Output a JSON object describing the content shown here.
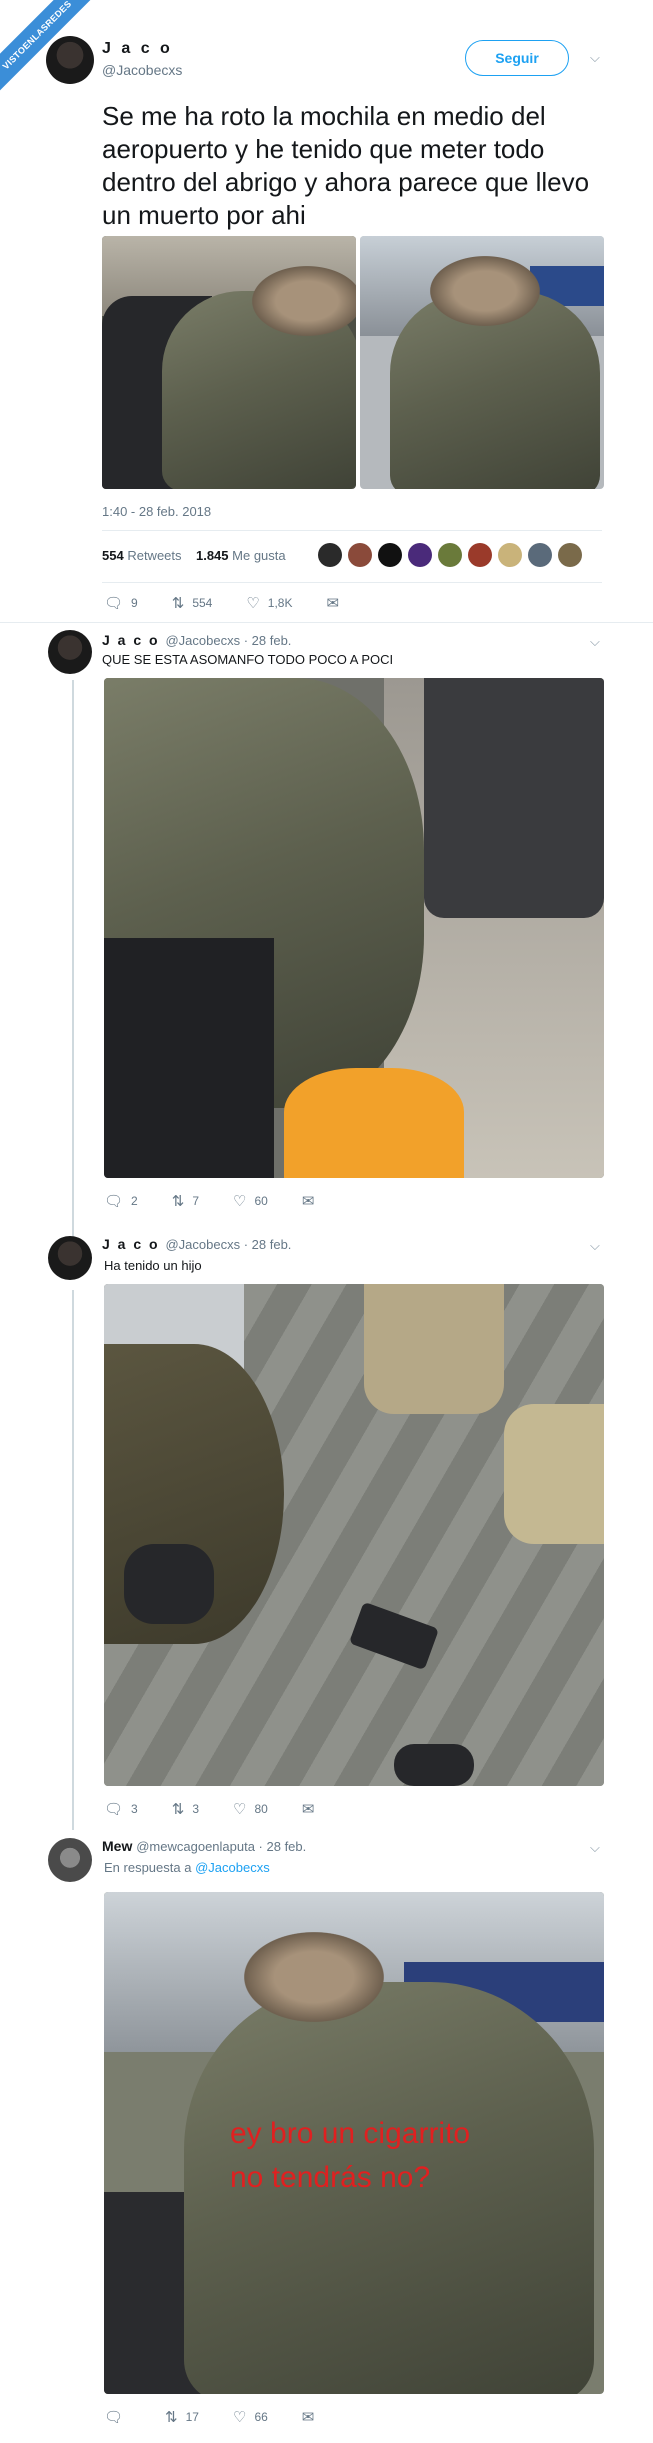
{
  "watermark": "VISTOENLASREDES",
  "tweet": {
    "name": "J a c o",
    "handle": "@Jacobecxs",
    "follow_label": "Seguir",
    "text": "Se me ha roto la mochila en medio del aeropuerto y he tenido que meter todo dentro del abrigo y ahora parece que llevo un muerto por ahi",
    "timestamp": "1:40 - 28 feb. 2018",
    "retweets_count": "554",
    "retweets_label": "Retweets",
    "likes_count": "1.845",
    "likes_label": "Me gusta",
    "actions": {
      "replies": "9",
      "retweets": "554",
      "likes": "1,8K"
    }
  },
  "replies": [
    {
      "name": "J a c o",
      "meta": "@Jacobecxs · 28 feb.",
      "text": "QUE SE ESTA ASOMANFO TODO POCO A POCI",
      "actions": {
        "replies": "2",
        "retweets": "7",
        "likes": "60"
      }
    },
    {
      "name": "J a c o",
      "meta": "@Jacobecxs · 28 feb.",
      "text": "Ha tenido un hijo",
      "actions": {
        "replies": "3",
        "retweets": "3",
        "likes": "80"
      }
    },
    {
      "name": "Mew",
      "meta": "@mewcagoenlaputa · 28 feb.",
      "reply_prefix": "En respuesta a",
      "reply_target": "@Jacobecxs",
      "overlay_line1": "ey bro un cigarrito",
      "overlay_line2": "no tendrás no?",
      "actions": {
        "replies": "",
        "retweets": "17",
        "likes": "66"
      }
    }
  ],
  "icons": {
    "reply": "reply-icon",
    "retweet": "retweet-icon",
    "like": "heart-icon",
    "message": "message-icon",
    "chevron": "chevron-down-icon"
  },
  "colors": {
    "accent": "#1da1f2",
    "muted": "#657786",
    "overlay_text": "#e02020"
  }
}
